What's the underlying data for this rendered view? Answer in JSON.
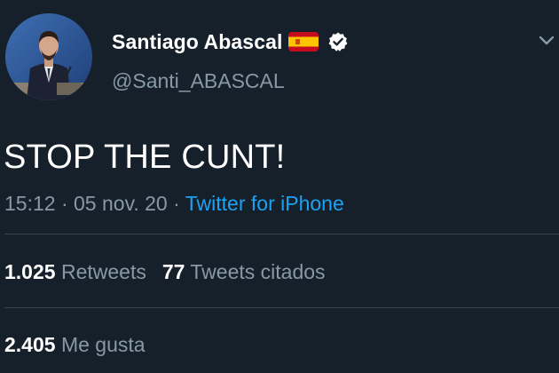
{
  "author": {
    "display_name": "Santiago Abascal",
    "handle": "@Santi_ABASCAL",
    "flag_icon": "spain-flag-icon",
    "verified_icon": "verified-badge-icon"
  },
  "tweet": {
    "text": "STOP THE CUNT!",
    "time": "15:12",
    "separator": " · ",
    "date": "05 nov. 20",
    "source": "Twitter for iPhone"
  },
  "stats": {
    "retweets_count": "1.025",
    "retweets_label": "Retweets",
    "quotes_count": "77",
    "quotes_label": "Tweets citados",
    "likes_count": "2.405",
    "likes_label": "Me gusta"
  },
  "colors": {
    "background": "#15202b",
    "text": "#ffffff",
    "secondary_text": "#8899a6",
    "link": "#1da1f2",
    "divider": "#38444d"
  }
}
